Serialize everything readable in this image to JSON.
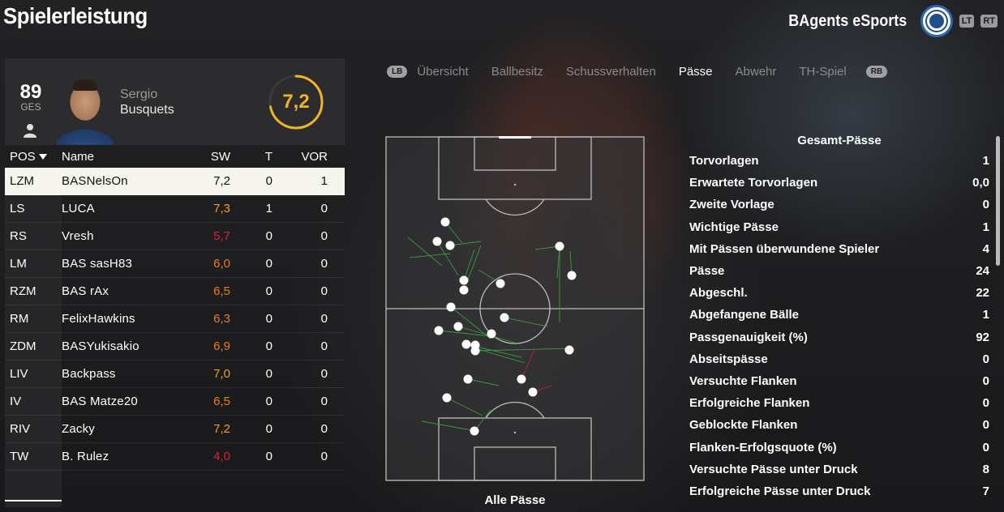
{
  "header": {
    "title": "Spielerleistung",
    "team_name": "BAgents eSports",
    "lt_label": "LT",
    "rt_label": "RT"
  },
  "player": {
    "overall": "89",
    "overall_label": "GES",
    "first_name": "Sergio",
    "last_name": "Busquets",
    "match_rating": "7,2",
    "match_rating_fraction": 0.72
  },
  "table": {
    "headers": {
      "pos": "POS",
      "name": "Name",
      "sw": "SW",
      "t": "T",
      "vor": "VOR"
    },
    "rows": [
      {
        "pos": "LZM",
        "name": "BASNelsOn",
        "sw": "7,2",
        "t": "0",
        "vor": "1",
        "color": "#111111"
      },
      {
        "pos": "LS",
        "name": "LUCA",
        "sw": "7,3",
        "t": "1",
        "vor": "0",
        "color": "#f0a020"
      },
      {
        "pos": "RS",
        "name": "Vresh",
        "sw": "5,7",
        "t": "0",
        "vor": "0",
        "color": "#d7263d"
      },
      {
        "pos": "LM",
        "name": "BAS sasH83",
        "sw": "6,0",
        "t": "0",
        "vor": "0",
        "color": "#f07a1a"
      },
      {
        "pos": "RZM",
        "name": "BAS  rAx",
        "sw": "6,5",
        "t": "0",
        "vor": "0",
        "color": "#f07a1a"
      },
      {
        "pos": "RM",
        "name": "FelixHawkins",
        "sw": "6,3",
        "t": "0",
        "vor": "0",
        "color": "#f07a1a"
      },
      {
        "pos": "ZDM",
        "name": "BASYukisakio",
        "sw": "6,9",
        "t": "0",
        "vor": "0",
        "color": "#f07a1a"
      },
      {
        "pos": "LIV",
        "name": "Backpass",
        "sw": "7,0",
        "t": "0",
        "vor": "0",
        "color": "#f0a020"
      },
      {
        "pos": "IV",
        "name": "BAS Matze20",
        "sw": "6,5",
        "t": "0",
        "vor": "0",
        "color": "#f07a1a"
      },
      {
        "pos": "RIV",
        "name": "Zacky",
        "sw": "7,2",
        "t": "0",
        "vor": "0",
        "color": "#f0a020"
      },
      {
        "pos": "TW",
        "name": "B. Rulez",
        "sw": "4,0",
        "t": "0",
        "vor": "0",
        "color": "#d7263d"
      }
    ]
  },
  "tabs": {
    "lb_label": "LB",
    "rb_label": "RB",
    "items": [
      "Übersicht",
      "Ballbesitz",
      "Schussverhalten",
      "Pässe",
      "Abwehr",
      "TH-Spiel"
    ],
    "active": "Pässe"
  },
  "pitch": {
    "caption": "Alle Pässe"
  },
  "stats": {
    "title": "Gesamt-Pässe",
    "rows": [
      {
        "label": "Torvorlagen",
        "value": "1"
      },
      {
        "label": "Erwartete Torvorlagen",
        "value": "0,0"
      },
      {
        "label": "Zweite Vorlage",
        "value": "0"
      },
      {
        "label": "Wichtige Pässe",
        "value": "1"
      },
      {
        "label": "Mit Pässen überwundene Spieler",
        "value": "4"
      },
      {
        "label": "Pässe",
        "value": "24"
      },
      {
        "label": "Abgeschl.",
        "value": "22"
      },
      {
        "label": "Abgefangene Bälle",
        "value": "1"
      },
      {
        "label": "Passgenauigkeit (%)",
        "value": "92"
      },
      {
        "label": "Abseitspässe",
        "value": "0"
      },
      {
        "label": "Versuchte Flanken",
        "value": "0"
      },
      {
        "label": "Erfolgreiche Flanken",
        "value": "0"
      },
      {
        "label": "Geblockte Flanken",
        "value": "0"
      },
      {
        "label": "Flanken-Erfolgsquote (%)",
        "value": "0"
      },
      {
        "label": "Versuchte Pässe unter Druck",
        "value": "8"
      },
      {
        "label": "Erfolgreiche Pässe unter Druck",
        "value": "7"
      }
    ]
  },
  "colors": {
    "accent": "#f0b429",
    "success_pass": "#3a9a3a",
    "failed_pass": "#c0282c"
  }
}
